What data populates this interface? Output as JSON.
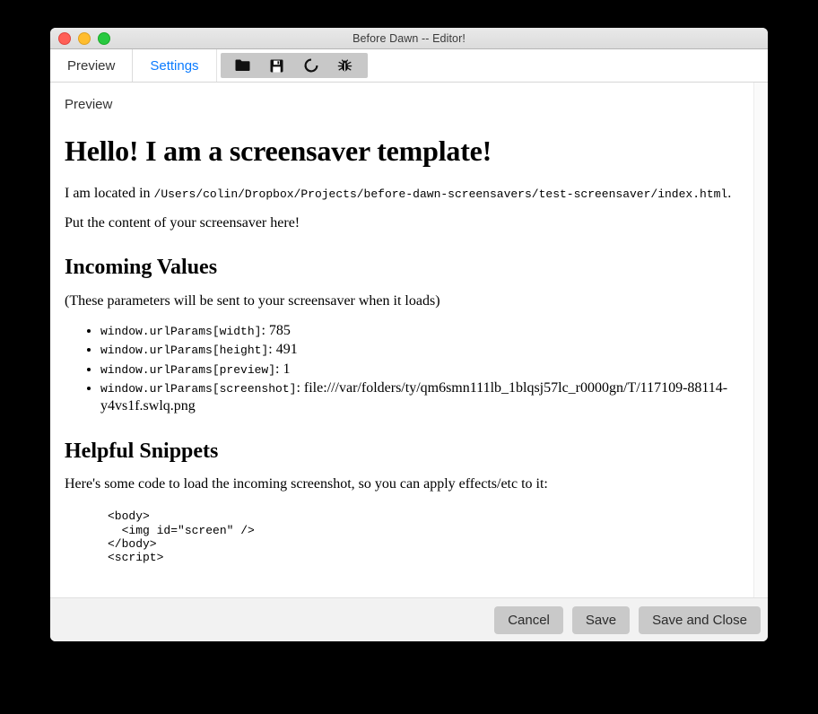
{
  "window": {
    "title": "Before Dawn -- Editor!",
    "traffic_lights": [
      "close",
      "minimize",
      "maximize"
    ]
  },
  "tabs": [
    {
      "label": "Preview",
      "active": true
    },
    {
      "label": "Settings",
      "active": false
    }
  ],
  "toolbar": {
    "buttons": [
      {
        "name": "open-folder-icon",
        "title": "Open"
      },
      {
        "name": "save-disk-icon",
        "title": "Save"
      },
      {
        "name": "reload-icon",
        "title": "Reload"
      },
      {
        "name": "bug-icon",
        "title": "Debug"
      }
    ]
  },
  "pane": {
    "label": "Preview"
  },
  "doc": {
    "heading": "Hello! I am a screensaver template!",
    "located_prefix": "I am located in ",
    "located_path": "/Users/colin/Dropbox/Projects/before-dawn-screensavers/test-screensaver/index.html",
    "located_suffix": ".",
    "put_content": "Put the content of your screensaver here!",
    "incoming_heading": "Incoming Values",
    "incoming_note": "(These parameters will be sent to your screensaver when it loads)",
    "params": [
      {
        "key": "window.urlParams[width]",
        "value": "785"
      },
      {
        "key": "window.urlParams[height]",
        "value": "491"
      },
      {
        "key": "window.urlParams[preview]",
        "value": "1"
      },
      {
        "key": "window.urlParams[screenshot]",
        "value": "file:///var/folders/ty/qm6smn111lb_1blqsj57lc_r0000gn/T/117109-88114-y4vs1f.swlq.png"
      }
    ],
    "snippets_heading": "Helpful Snippets",
    "snippets_note": "Here's some code to load the incoming screenshot, so you can apply effects/etc to it:",
    "snippet_code": "<body>\n  <img id=\"screen\" />\n</body>\n<script>"
  },
  "footer": {
    "cancel_label": "Cancel",
    "save_label": "Save",
    "save_close_label": "Save and Close"
  },
  "colors": {
    "link_blue": "#0a7bff",
    "toolbar_gray": "#c8c8c8",
    "footer_gray": "#f2f2f2",
    "button_gray": "#c9c9c9"
  }
}
